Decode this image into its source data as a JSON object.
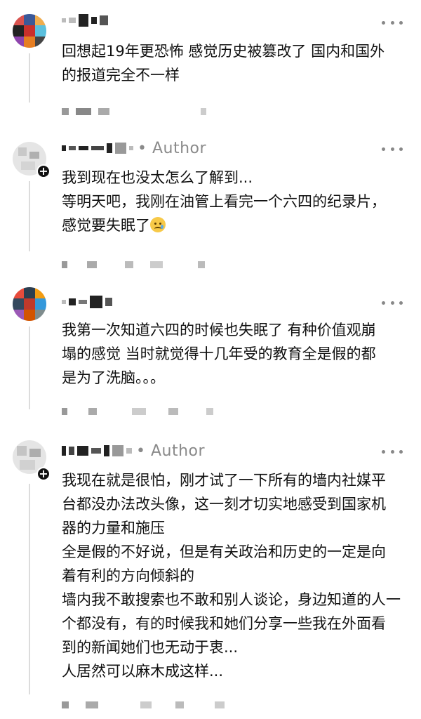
{
  "colors": {
    "text": "#111111",
    "muted": "#8a8a8a",
    "thread": "#dcdcdc",
    "background": "#ffffff"
  },
  "comments": [
    {
      "author_tag": "",
      "lines": [
        "回想起19年更恐怖  感觉历史被篡改了 国内和国外",
        "的报道完全不一样"
      ],
      "has_add_badge": false,
      "more_icon": "more-horizontal-icon"
    },
    {
      "author_tag": "• Author",
      "lines": [
        "我到现在也没太怎么了解到...",
        "等明天吧，我刚在油管上看完一个六四的纪录片，",
        "感觉要失眠了"
      ],
      "emoji": "crying-face-emoji",
      "has_add_badge": true,
      "more_icon": "more-horizontal-icon"
    },
    {
      "author_tag": "",
      "lines": [
        "我第一次知道六四的时候也失眠了  有种价值观崩",
        "塌的感觉  当时就觉得十几年受的教育全是假的都",
        "是为了洗脑。。。"
      ],
      "has_add_badge": false,
      "more_icon": "more-horizontal-icon"
    },
    {
      "author_tag": "• Author",
      "lines": [
        "我现在就是很怕，刚才试了一下所有的墙内社媒平",
        "台都没办法改头像，这一刻才切实地感受到国家机",
        "器的力量和施压",
        "全是假的不好说，但是有关政治和历史的一定是向",
        "着有利的方向倾斜的",
        "墙内我不敢搜索也不敢和别人谈论，身边知道的人一",
        "个都没有，有的时候我和她们分享一些我在外面看",
        "到的新闻她们也无动于衷...",
        "人居然可以麻木成这样..."
      ],
      "has_add_badge": true,
      "more_icon": "more-horizontal-icon"
    }
  ]
}
